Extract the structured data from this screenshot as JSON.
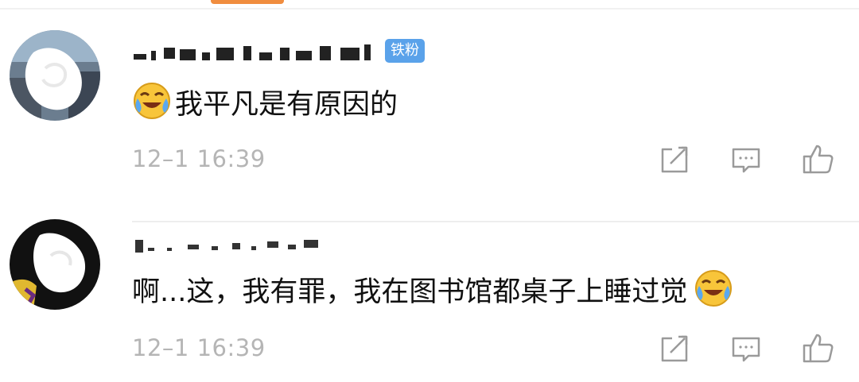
{
  "comments": [
    {
      "badge": "铁粉",
      "text": "我平凡是有原因的",
      "emoji": "laughing-crying-emoji",
      "timestamp": "12–1 16:39",
      "actions": [
        "repost-icon",
        "reply-icon",
        "like-icon"
      ]
    },
    {
      "text": "啊...这，我有罪，我在图书馆都桌子上睡过觉",
      "emoji": "laughing-crying-emoji",
      "timestamp": "12–1 16:39",
      "actions": [
        "repost-icon",
        "reply-icon",
        "like-icon"
      ]
    }
  ],
  "colors": {
    "badge": "#5aa2ea",
    "timestamp": "#b5b5b5",
    "icon": "#9a9a9a",
    "tab_indicator": "#f08d3f"
  }
}
